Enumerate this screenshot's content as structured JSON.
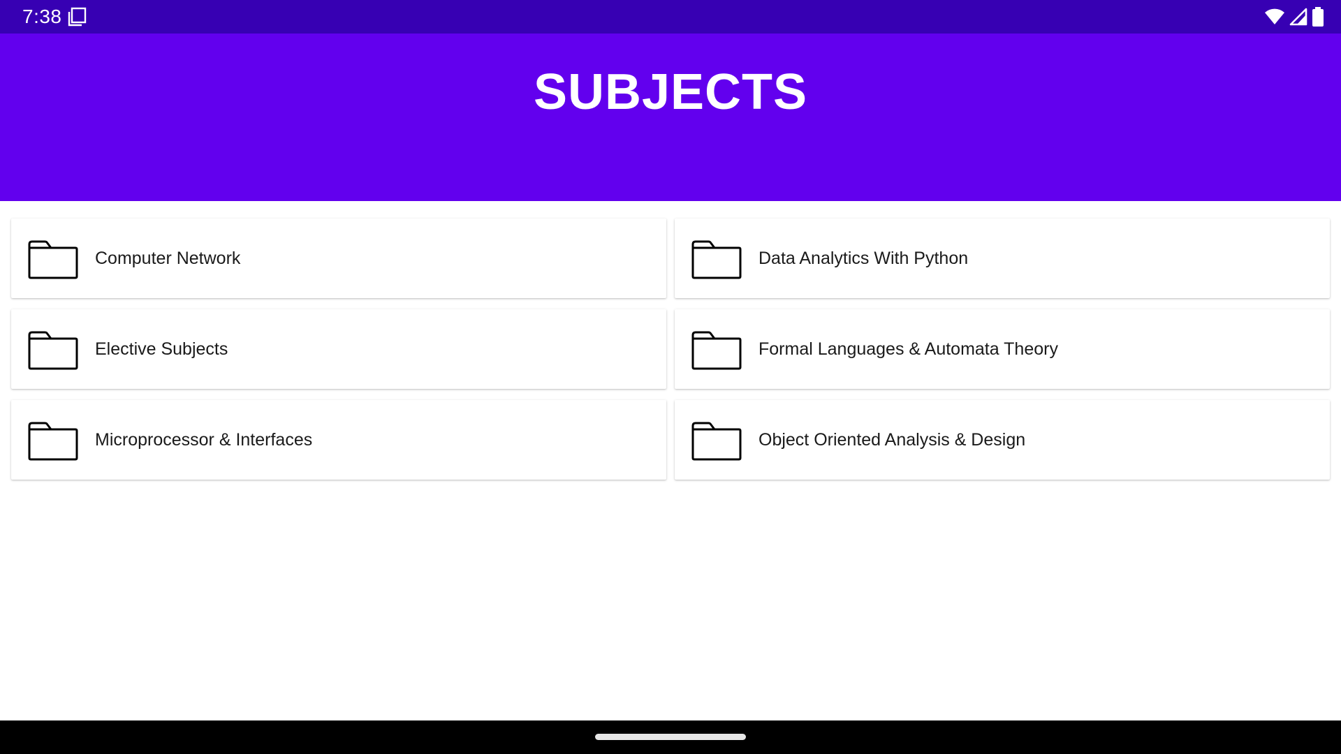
{
  "status_bar": {
    "time": "7:38",
    "notification_icon": "screenshot-icon",
    "right_icons": [
      "wifi-icon",
      "cellular-signal-icon",
      "battery-icon"
    ]
  },
  "app_bar": {
    "title": "SUBJECTS",
    "color": "#6200ee",
    "status_color": "#3700b3"
  },
  "subjects": [
    {
      "label": "Computer Network",
      "icon": "folder-icon"
    },
    {
      "label": "Data Analytics With Python",
      "icon": "folder-icon"
    },
    {
      "label": "Elective Subjects",
      "icon": "folder-icon"
    },
    {
      "label": "Formal Languages & Automata Theory",
      "icon": "folder-icon"
    },
    {
      "label": "Microprocessor & Interfaces",
      "icon": "folder-icon"
    },
    {
      "label": "Object Oriented Analysis & Design",
      "icon": "folder-icon"
    }
  ],
  "nav_bar": {
    "gesture_handle": "home-gesture-handle"
  }
}
